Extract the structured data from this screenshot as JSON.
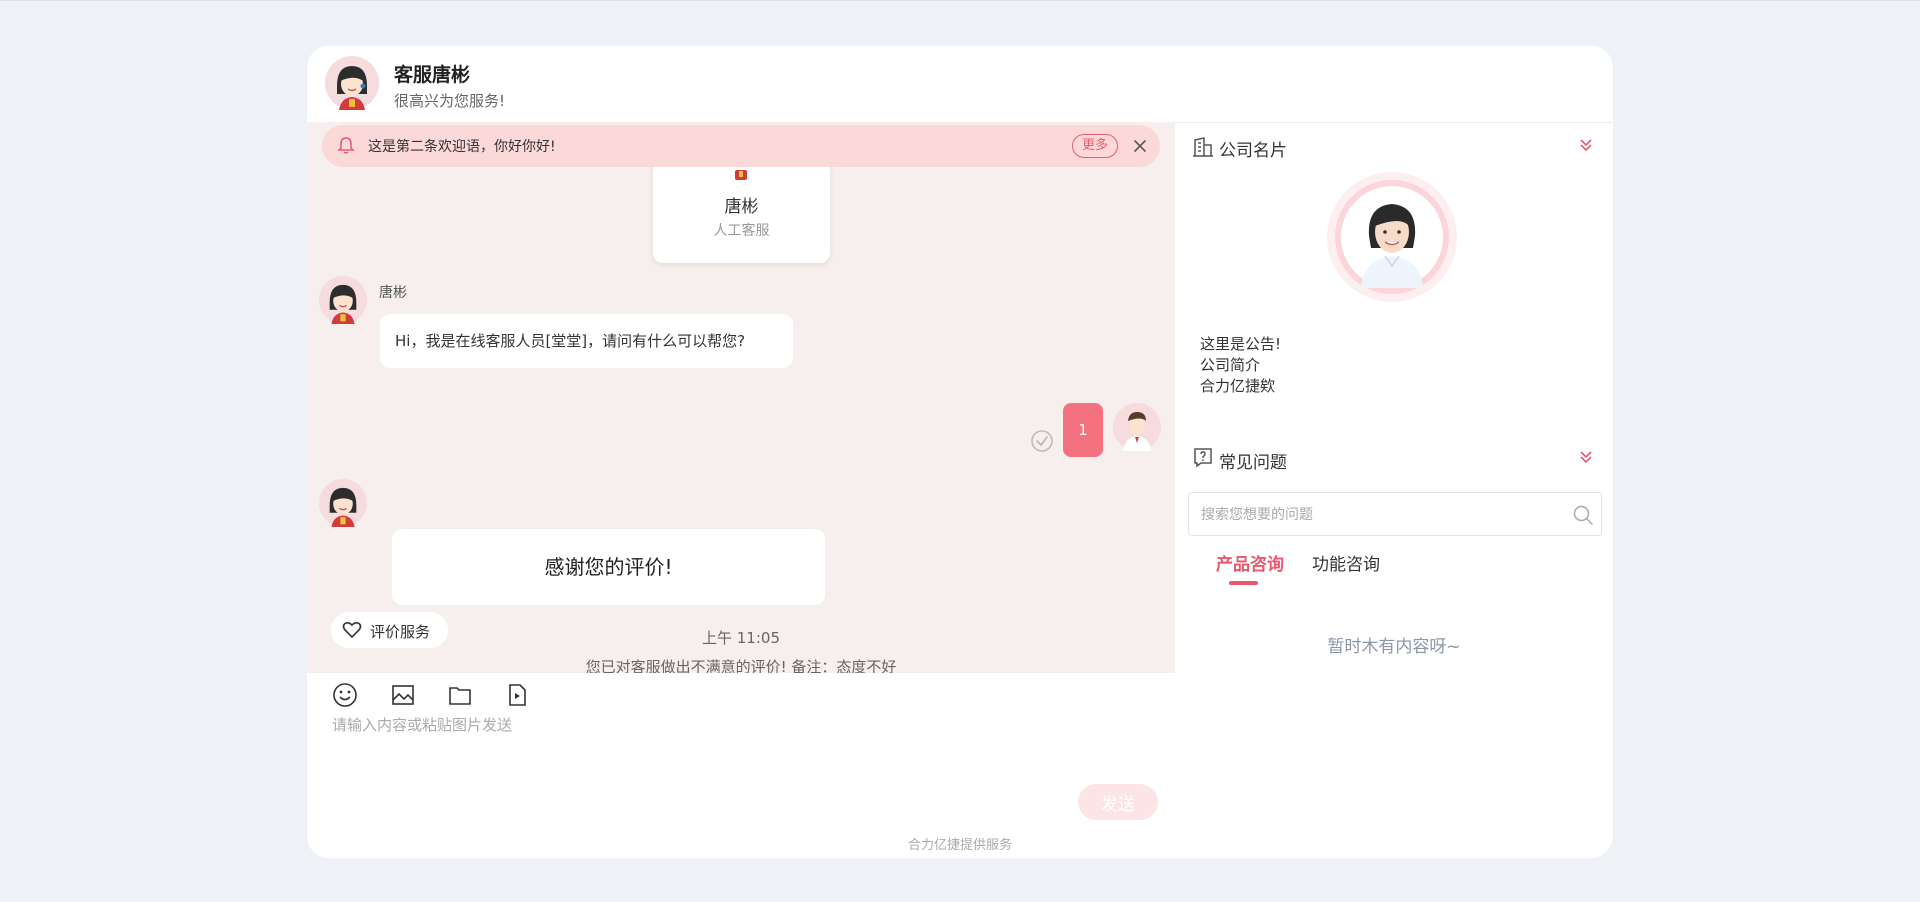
{
  "header": {
    "name": "客服唐彬",
    "subtitle": "很高兴为您服务!"
  },
  "notice": {
    "text": "这是第二条欢迎语，你好你好!",
    "more_label": "更多"
  },
  "agent_card": {
    "name": "唐彬",
    "role": "人工客服"
  },
  "messages": {
    "sender_name": "唐彬",
    "greeting": "Hi，我是在线客服人员[堂堂]，请问有什么可以帮您?",
    "user_message": "1",
    "thanks": "感谢您的评价!",
    "time": "上午 11:05",
    "rating_note": "您已对客服做出不满意的评价! 备注：态度不好"
  },
  "rate_button": {
    "label": "评价服务"
  },
  "composer": {
    "placeholder": "请输入内容或粘贴图片发送",
    "send_label": "发送"
  },
  "footer": {
    "text": "合力亿捷提供服务"
  },
  "side": {
    "company_card_title": "公司名片",
    "announcement": [
      "这里是公告!",
      "公司简介",
      "合力亿捷欸"
    ],
    "faq_title": "常见问题",
    "faq_search_placeholder": "搜索您想要的问题",
    "tabs": [
      {
        "label": "产品咨询",
        "active": true
      },
      {
        "label": "功能咨询",
        "active": false
      }
    ],
    "empty_text": "暂时木有内容呀~"
  },
  "colors": {
    "accent": "#e8586e",
    "notice_bg": "#fcd9d9",
    "chat_bg": "#f7eeee",
    "user_bubble": "#f4717f",
    "send_button_disabled": "#fde4e6"
  },
  "icons": {
    "notice": "bell-icon",
    "close": "close-icon",
    "confirm": "check-circle-icon",
    "rate": "heart-icon",
    "toolbar": [
      "emoji-icon",
      "image-icon",
      "folder-icon",
      "video-file-icon"
    ],
    "company": "building-icon",
    "faq": "question-icon",
    "collapse": "chevron-double-down-icon",
    "search": "search-icon"
  }
}
